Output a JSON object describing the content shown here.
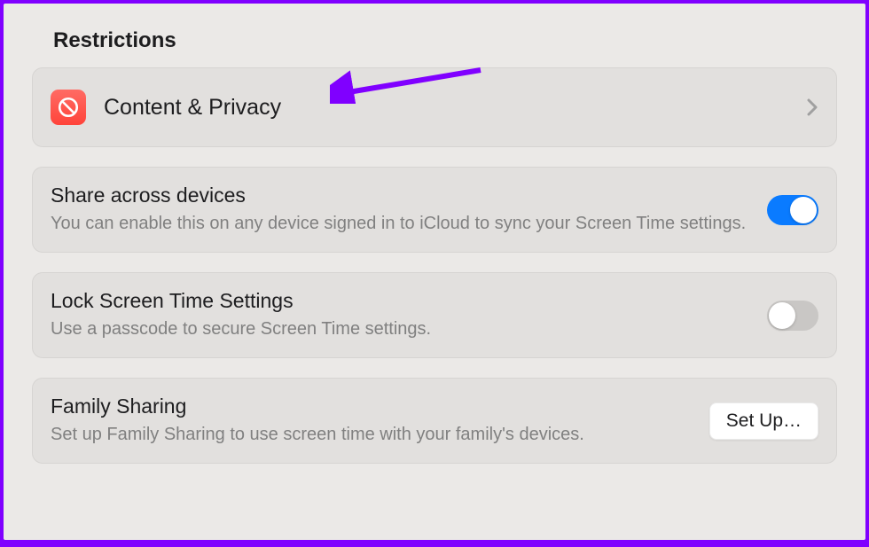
{
  "section": {
    "heading": "Restrictions"
  },
  "contentPrivacy": {
    "label": "Content & Privacy",
    "iconName": "prohibit-icon"
  },
  "shareAcrossDevices": {
    "title": "Share across devices",
    "description": "You can enable this on any device signed in to iCloud to sync your Screen Time settings.",
    "enabled": true
  },
  "lockScreenTime": {
    "title": "Lock Screen Time Settings",
    "description": "Use a passcode to secure Screen Time settings.",
    "enabled": false
  },
  "familySharing": {
    "title": "Family Sharing",
    "description": "Set up Family Sharing to use screen time with your family's devices.",
    "buttonLabel": "Set Up…"
  },
  "annotation": {
    "arrowColor": "#8000ff"
  }
}
